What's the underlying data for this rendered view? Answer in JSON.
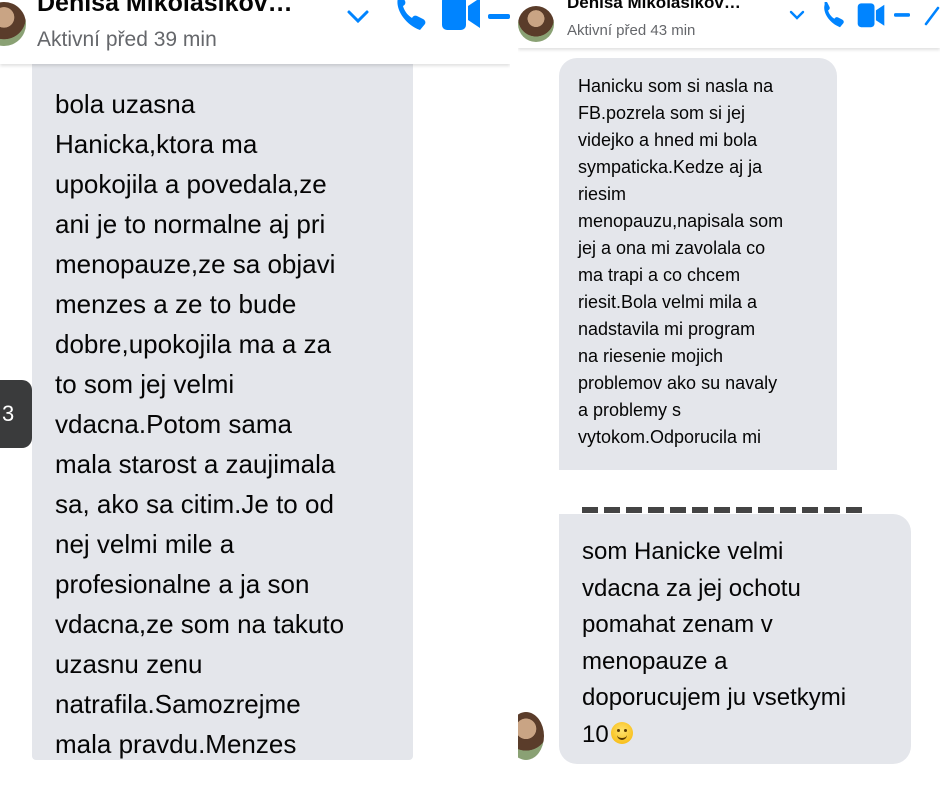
{
  "colors": {
    "accent": "#0084ff",
    "bubble": "#e4e6eb",
    "text": "#050505",
    "muted": "#65676b"
  },
  "left_panel": {
    "header": {
      "name": "Denisa Mikolasikov…",
      "status": "Aktivní před 39 min",
      "icons": [
        "chevron-down-icon",
        "phone-icon",
        "video-camera-icon",
        "minimize-icon"
      ]
    },
    "side_tab_label": "3",
    "message": {
      "lines": [
        "bola uzasna",
        "Hanicka,ktora ma",
        "upokojila a povedala,ze",
        "ani je to normalne aj pri",
        "menopauze,ze sa objavi",
        "menzes a ze to bude",
        "dobre,upokojila ma a za",
        "to som jej velmi",
        "vdacna.Potom sama",
        "mala starost a zaujimala",
        "sa, ako sa citim.Je to od",
        "nej velmi mile a",
        "profesionalne a ja son",
        "vdacna,ze som na takuto",
        "uzasnu zenu",
        "natrafila.Samozrejme",
        "mala pravdu.Menzes"
      ]
    }
  },
  "right_panel": {
    "header": {
      "name": "Denisa Mikolasikov…",
      "status": "Aktivní před 43 min",
      "icons": [
        "chevron-down-icon",
        "phone-icon",
        "video-camera-icon",
        "minimize-icon"
      ]
    },
    "message_top": {
      "lines": [
        "Hanicku som si nasla na",
        "FB.pozrela som si jej",
        "videjko a hned mi bola",
        "sympaticka.Kedze aj ja",
        "riesim",
        "menopauzu,napisala som",
        "jej a ona mi zavolala co",
        "ma trapi a co chcem",
        "riesit.Bola velmi mila a",
        "nadstavila mi program",
        "na riesenie mojich",
        "problemov ako su navaly",
        "a problemy s",
        "vytokom.Odporucila mi"
      ]
    },
    "message_bottom": {
      "lines": [
        "som Hanicke velmi",
        "vdacna za jej ochotu",
        "pomahat zenam v",
        "menopauze a",
        "doporucujem ju vsetkymi",
        "10"
      ],
      "emoji": "slightly-smiling-face-emoji"
    }
  }
}
